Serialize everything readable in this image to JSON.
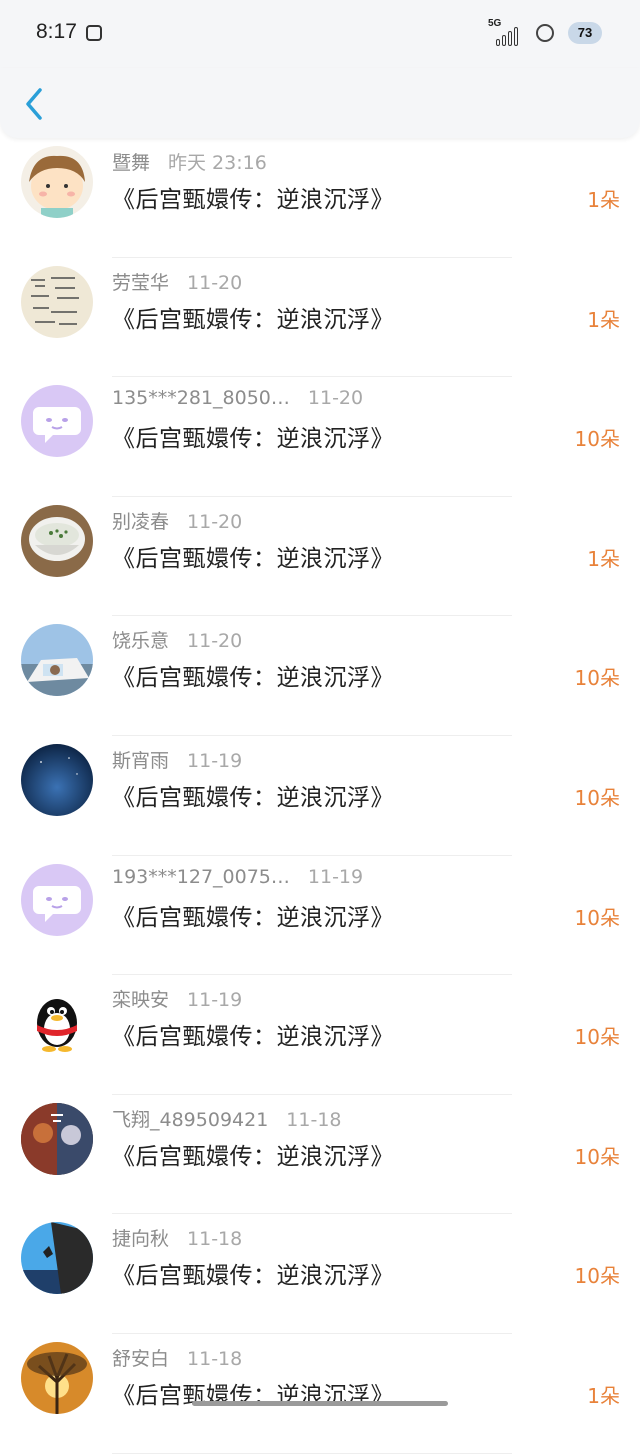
{
  "status_bar": {
    "time": "8:17",
    "network": "5G",
    "battery": "73"
  },
  "list": [
    {
      "name": "暨舞",
      "date": "昨天 23:16",
      "title": "《后宫甄嬛传：逆浪沉浮》",
      "amount": "1朵",
      "avatar": "cartoon-boy"
    },
    {
      "name": "劳莹华",
      "date": "11-20",
      "title": "《后宫甄嬛传：逆浪沉浮》",
      "amount": "1朵",
      "avatar": "calligraphy"
    },
    {
      "name": "135***281_8050…",
      "date": "11-20",
      "title": "《后宫甄嬛传：逆浪沉浮》",
      "amount": "10朵",
      "avatar": "default-chat"
    },
    {
      "name": "别凌春",
      "date": "11-20",
      "title": "《后宫甄嬛传：逆浪沉浮》",
      "amount": "1朵",
      "avatar": "bowl"
    },
    {
      "name": "饶乐意",
      "date": "11-20",
      "title": "《后宫甄嬛传：逆浪沉浮》",
      "amount": "10朵",
      "avatar": "car"
    },
    {
      "name": "斯宵雨",
      "date": "11-19",
      "title": "《后宫甄嬛传：逆浪沉浮》",
      "amount": "10朵",
      "avatar": "night-sky"
    },
    {
      "name": "193***127_0075…",
      "date": "11-19",
      "title": "《后宫甄嬛传：逆浪沉浮》",
      "amount": "10朵",
      "avatar": "default-chat"
    },
    {
      "name": "栾映安",
      "date": "11-19",
      "title": "《后宫甄嬛传：逆浪沉浮》",
      "amount": "10朵",
      "avatar": "penguin"
    },
    {
      "name": "飞翔_489509421",
      "date": "11-18",
      "title": "《后宫甄嬛传：逆浪沉浮》",
      "amount": "10朵",
      "avatar": "poster"
    },
    {
      "name": "捷向秋",
      "date": "11-18",
      "title": "《后宫甄嬛传：逆浪沉浮》",
      "amount": "10朵",
      "avatar": "climber"
    },
    {
      "name": "舒安白",
      "date": "11-18",
      "title": "《后宫甄嬛传：逆浪沉浮》",
      "amount": "1朵",
      "avatar": "sunset-tree"
    }
  ],
  "colors": {
    "accent_amount": "#e8823a",
    "back_arrow": "#2a9fd8",
    "header_bg": "#f5f6f8"
  }
}
